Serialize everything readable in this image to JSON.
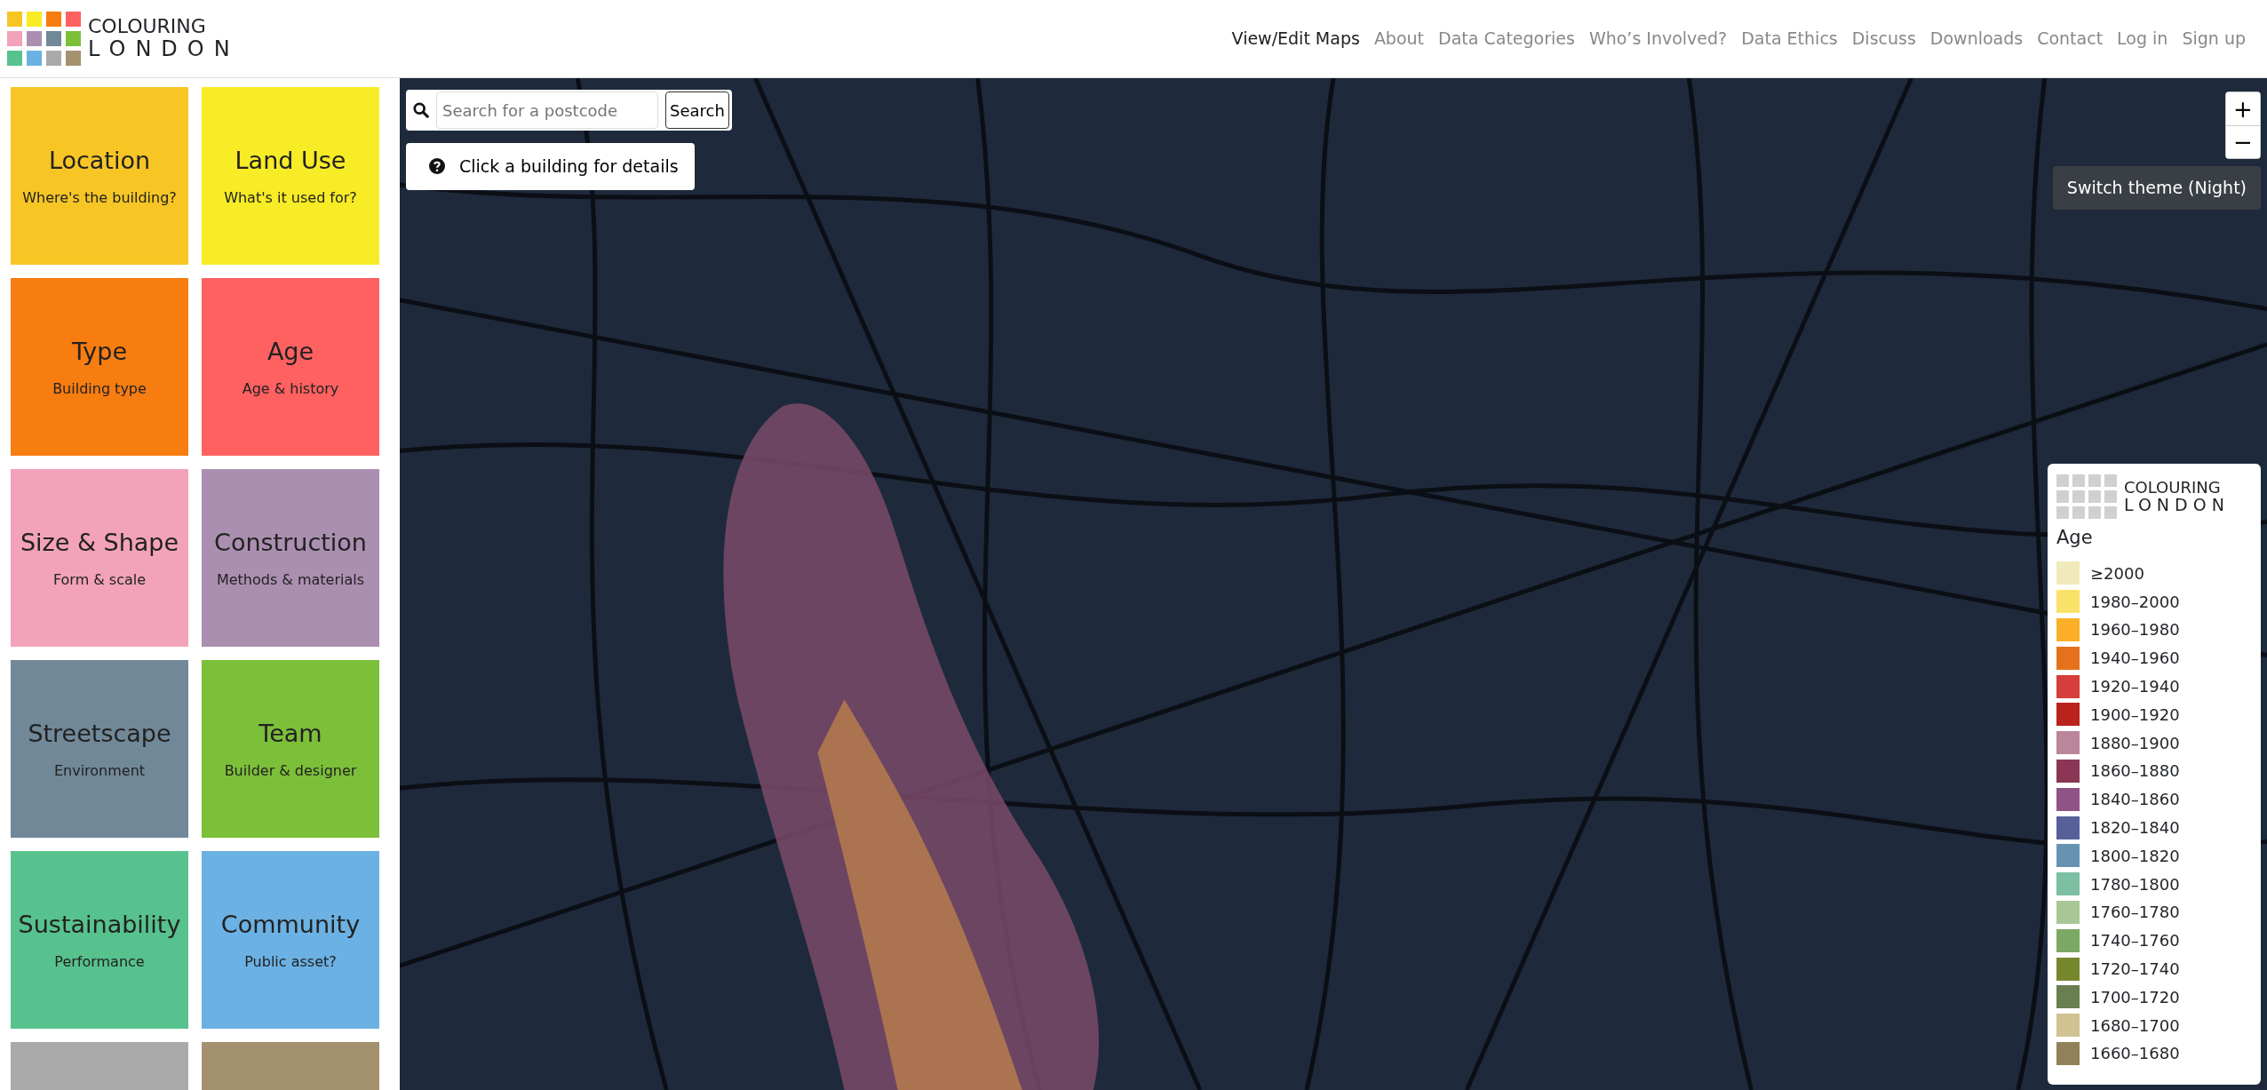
{
  "logo": {
    "line_1": "COLOURING",
    "line_2": "LONDON"
  },
  "nav": [
    {
      "label": "View/Edit Maps",
      "selected": true
    },
    {
      "label": "About",
      "selected": false
    },
    {
      "label": "Data Categories",
      "selected": false
    },
    {
      "label": "Who’s Involved?",
      "selected": false
    },
    {
      "label": "Data Ethics",
      "selected": false
    },
    {
      "label": "Discuss",
      "selected": false
    },
    {
      "label": "Downloads",
      "selected": false
    },
    {
      "label": "Contact",
      "selected": false
    },
    {
      "label": "Log in",
      "selected": false
    },
    {
      "label": "Sign up",
      "selected": false
    }
  ],
  "categories": [
    {
      "title": "Location",
      "subtitle": "Where's the building?",
      "color": "#f7c625"
    },
    {
      "title": "Land Use",
      "subtitle": "What's it used for?",
      "color": "#f7ec25"
    },
    {
      "title": "Type",
      "subtitle": "Building type",
      "color": "#f77d11"
    },
    {
      "title": "Age",
      "subtitle": "Age & history",
      "color": "#ff6161"
    },
    {
      "title": "Size & Shape",
      "subtitle": "Form & scale",
      "color": "#f2a2b9"
    },
    {
      "title": "Construction",
      "subtitle": "Methods & materials",
      "color": "#ab8fb0"
    },
    {
      "title": "Streetscape",
      "subtitle": "Environment",
      "color": "#718899"
    },
    {
      "title": "Team",
      "subtitle": "Builder & designer",
      "color": "#7cbf39"
    },
    {
      "title": "Sustainability",
      "subtitle": "Performance",
      "color": "#57c28e"
    },
    {
      "title": "Community",
      "subtitle": "Public asset?",
      "color": "#6bb1e3"
    },
    {
      "color": "#aaaaaa"
    },
    {
      "color": "#a3916f"
    }
  ],
  "map": {
    "search": {
      "placeholder": "Search for a postcode",
      "button": "Search"
    },
    "help_button": "Click a building for details",
    "zoom_in": "+",
    "zoom_out": "−",
    "theme_button": "Switch theme (Night)",
    "legend": {
      "logo": {
        "line_1": "COLOURING",
        "line_2": "LONDON"
      },
      "title": "Age",
      "items": [
        {
          "label": "≥2000",
          "color": "#f0eaba"
        },
        {
          "label": "1980–2000",
          "color": "#fae269"
        },
        {
          "label": "1960–1980",
          "color": "#fbaf27"
        },
        {
          "label": "1940–1960",
          "color": "#e6711d"
        },
        {
          "label": "1920–1940",
          "color": "#d73d3a"
        },
        {
          "label": "1900–1920",
          "color": "#ba221c"
        },
        {
          "label": "1880–1900",
          "color": "#bb859b"
        },
        {
          "label": "1860–1880",
          "color": "#8b3654"
        },
        {
          "label": "1840–1860",
          "color": "#8f5385"
        },
        {
          "label": "1820–1840",
          "color": "#56619b"
        },
        {
          "label": "1800–1820",
          "color": "#6793b2"
        },
        {
          "label": "1780–1800",
          "color": "#7cbfa3"
        },
        {
          "label": "1760–1780",
          "color": "#a7c796"
        },
        {
          "label": "1740–1760",
          "color": "#7ca866"
        },
        {
          "label": "1720–1740",
          "color": "#76872c"
        },
        {
          "label": "1700–1720",
          "color": "#6a7f4f"
        },
        {
          "label": "1680–1700",
          "color": "#d0c291"
        },
        {
          "label": "1660–1680",
          "color": "#918158"
        }
      ]
    }
  }
}
